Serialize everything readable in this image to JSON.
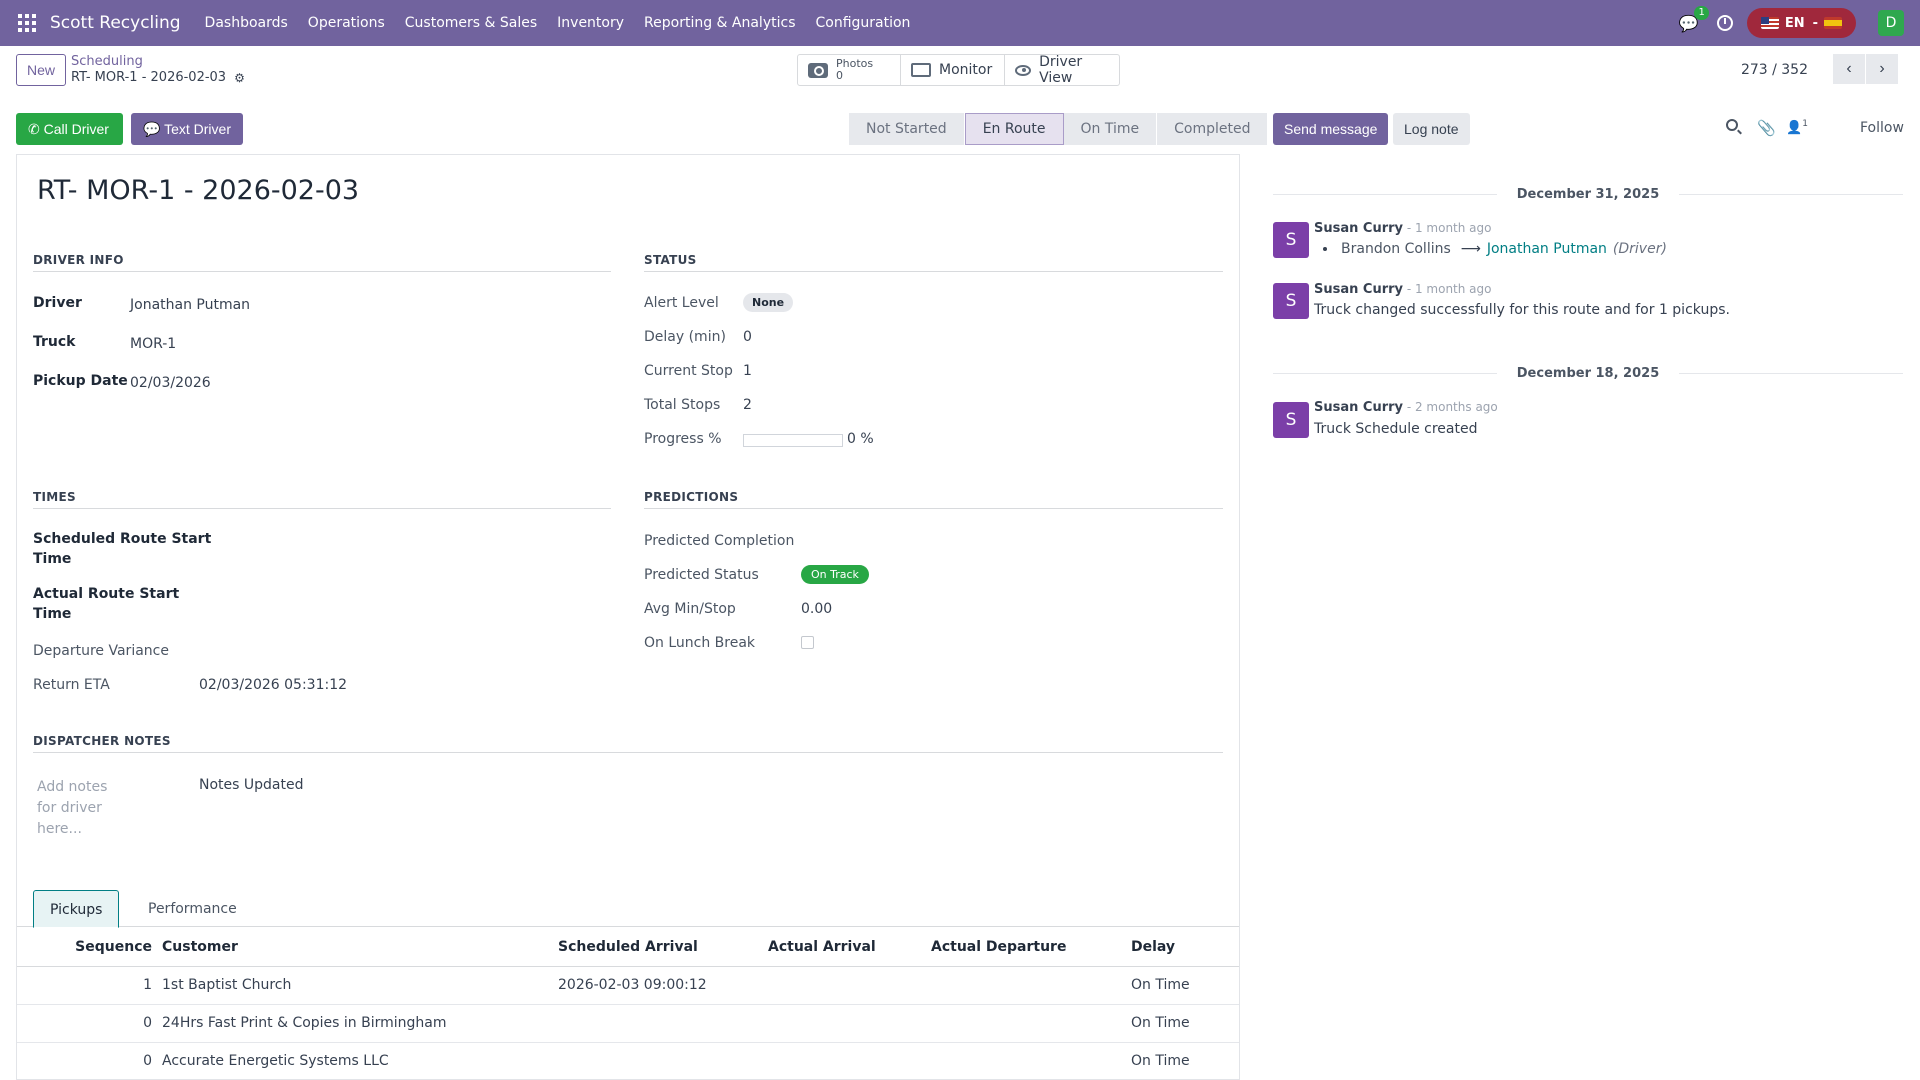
{
  "navbar": {
    "brand": "Scott Recycling",
    "menu": [
      "Dashboards",
      "Operations",
      "Customers & Sales",
      "Inventory",
      "Reporting & Analytics",
      "Configuration"
    ],
    "chat_count": "1",
    "lang_label": "EN",
    "user_initial": "D"
  },
  "control": {
    "new_label": "New",
    "breadcrumb": "Scheduling",
    "record_name": "RT- MOR-1 - 2026-02-03",
    "photos_label": "Photos",
    "photos_count": "0",
    "monitor_label": "Monitor",
    "driver_view_label": "Driver View",
    "pager": "273 / 352",
    "prev_arrow": "‹",
    "next_arrow": "›"
  },
  "actions": {
    "call_driver": "Call Driver",
    "text_driver": "Text Driver",
    "stages": [
      "Not Started",
      "En Route",
      "On Time",
      "Completed"
    ],
    "active_stage": "En Route"
  },
  "form": {
    "title": "RT- MOR-1 - 2026-02-03",
    "driver_info": {
      "heading": "DRIVER INFO",
      "driver_label": "Driver",
      "driver": "Jonathan Putman",
      "truck_label": "Truck",
      "truck": "MOR-1",
      "pickup_date_label": "Pickup Date",
      "pickup_date": "02/03/2026"
    },
    "status": {
      "heading": "STATUS",
      "alert_label": "Alert Level",
      "alert": "None",
      "delay_label": "Delay (min)",
      "delay": "0",
      "current_stop_label": "Current Stop",
      "current_stop": "1",
      "total_stops_label": "Total Stops",
      "total_stops": "2",
      "progress_label": "Progress %",
      "progress": "0 %",
      "progress_value": 0
    },
    "times": {
      "heading": "TIMES",
      "sched_start_label_1": "Scheduled Route Start",
      "sched_start_label_2": "Time",
      "actual_start_label_1": "Actual Route Start",
      "actual_start_label_2": "Time",
      "departure_variance_label": "Departure Variance",
      "return_eta_label": "Return ETA",
      "return_eta": "02/03/2026 05:31:12"
    },
    "predictions": {
      "heading": "PREDICTIONS",
      "completion_label": "Predicted Completion",
      "status_label": "Predicted Status",
      "status": "On Track",
      "avg_label": "Avg Min/Stop",
      "avg": "0.00",
      "lunch_label": "On Lunch Break"
    },
    "notes": {
      "heading": "DISPATCHER NOTES",
      "placeholder": "Add notes for driver here...",
      "value": "Notes Updated"
    }
  },
  "tabs": [
    "Pickups",
    "Performance"
  ],
  "table": {
    "headers": [
      "Sequence",
      "Customer",
      "Scheduled Arrival",
      "Actual Arrival",
      "Actual Departure",
      "Delay"
    ],
    "rows": [
      {
        "seq": "1",
        "customer": "1st Baptist Church",
        "scheduled": "2026-02-03 09:00:12",
        "actual_arrival": "",
        "actual_departure": "",
        "delay": "On Time"
      },
      {
        "seq": "0",
        "customer": "24Hrs Fast Print & Copies in Birmingham",
        "scheduled": "",
        "actual_arrival": "",
        "actual_departure": "",
        "delay": "On Time"
      },
      {
        "seq": "0",
        "customer": "Accurate Energetic Systems LLC",
        "scheduled": "",
        "actual_arrival": "",
        "actual_departure": "",
        "delay": "On Time"
      }
    ]
  },
  "chatter": {
    "send_message": "Send message",
    "log_note": "Log note",
    "followers_count": "1",
    "follow": "Follow",
    "date_1": "December 31, 2025",
    "date_2": "December 18, 2025",
    "messages": [
      {
        "initial": "S",
        "author": "Susan Curry",
        "time": " - 1 month ago",
        "old_value": "Brandon Collins",
        "new_value": "Jonathan Putman",
        "field": "(Driver)"
      },
      {
        "initial": "S",
        "author": "Susan Curry",
        "time": " - 1 month ago",
        "body": "Truck changed successfully for this route and for 1 pickups."
      },
      {
        "initial": "S",
        "author": "Susan Curry",
        "time": " - 2 months ago",
        "body": "Truck Schedule created"
      }
    ]
  },
  "colors": {
    "brand": "#71639e",
    "success": "#28a745",
    "link": "#017e84"
  }
}
